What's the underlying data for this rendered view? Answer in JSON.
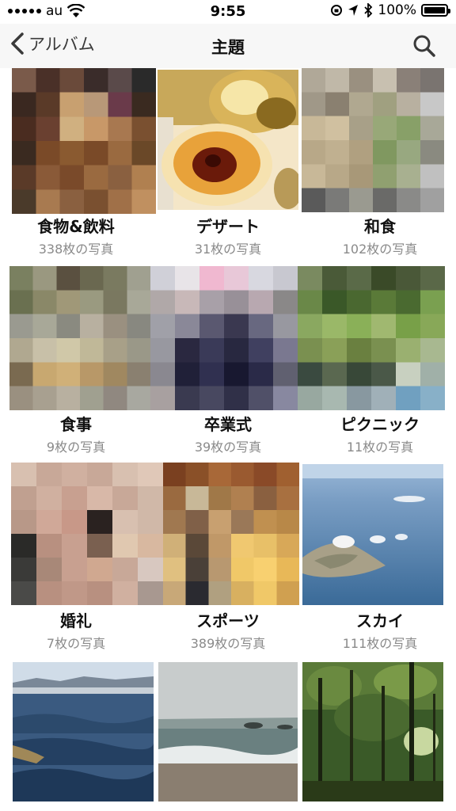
{
  "status_bar": {
    "carrier": "au",
    "time": "9:55",
    "battery": "100%",
    "icons": [
      "signal-icon",
      "wifi-icon",
      "orientation-lock-icon",
      "location-icon",
      "bluetooth-icon",
      "battery-icon"
    ]
  },
  "nav": {
    "back_label": "アルバム",
    "title": "主題",
    "search_icon": "search-icon"
  },
  "albums": [
    {
      "name": "食物&飲料",
      "count": "338枚の写真"
    },
    {
      "name": "デザート",
      "count": "31枚の写真"
    },
    {
      "name": "和食",
      "count": "102枚の写真"
    },
    {
      "name": "食事",
      "count": "9枚の写真"
    },
    {
      "name": "卒業式",
      "count": "39枚の写真"
    },
    {
      "name": "ピクニック",
      "count": "11枚の写真"
    },
    {
      "name": "婚礼",
      "count": "7枚の写真"
    },
    {
      "name": "スポーツ",
      "count": "389枚の写真"
    },
    {
      "name": "スカイ",
      "count": "111枚の写真"
    }
  ],
  "colors": {
    "accent": "#3a3a3a",
    "nav_background": "#f7f7f7",
    "count_text": "#8a8a8a"
  }
}
